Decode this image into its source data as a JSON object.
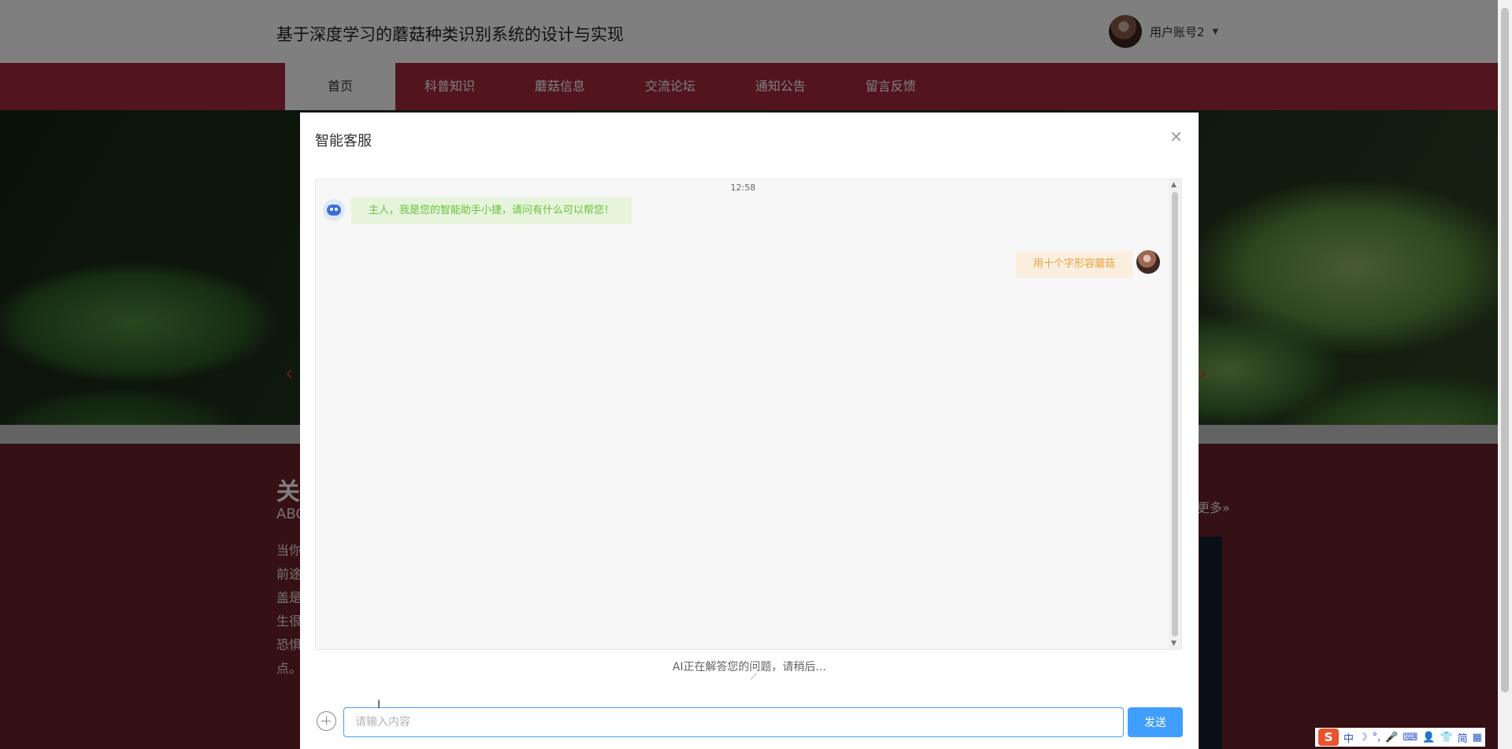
{
  "site": {
    "title": "基于深度学习的蘑菇种类识别系统的设计与实现",
    "user": {
      "name": "用户账号2",
      "caret": "▼"
    }
  },
  "nav": {
    "items": [
      "首页",
      "科普知识",
      "蘑菇信息",
      "交流论坛",
      "通知公告",
      "留言反馈"
    ],
    "active_index": 0
  },
  "banner": {
    "prev": "‹",
    "next": "›"
  },
  "about": {
    "title": "关于",
    "subtitle": "ABOUT",
    "lines": [
      "当你",
      "前途",
      "盖是",
      "生很",
      "恐惧",
      "点。"
    ],
    "more": "更多»"
  },
  "dialog": {
    "title": "智能客服",
    "close": "×",
    "time": "12:58",
    "bot_message": "主人，我是您的智能助手小捷，请问有什么可以帮您！",
    "user_message": "用十个字形容蘑菇",
    "ai_status": "AI正在解答您的问题，请稍后...",
    "input_placeholder": "请输入内容",
    "input_value": "",
    "send_label": "发送"
  },
  "ime_tray": {
    "logo": "S",
    "items": [
      "中",
      "☽",
      "°,",
      "🎤",
      "⌨",
      "👤",
      "👕",
      "简",
      "▦"
    ]
  },
  "colors": {
    "nav_bg": "#a42a3b",
    "primary": "#409eff",
    "bot_text": "#67c23a",
    "user_text": "#e6a23c"
  }
}
